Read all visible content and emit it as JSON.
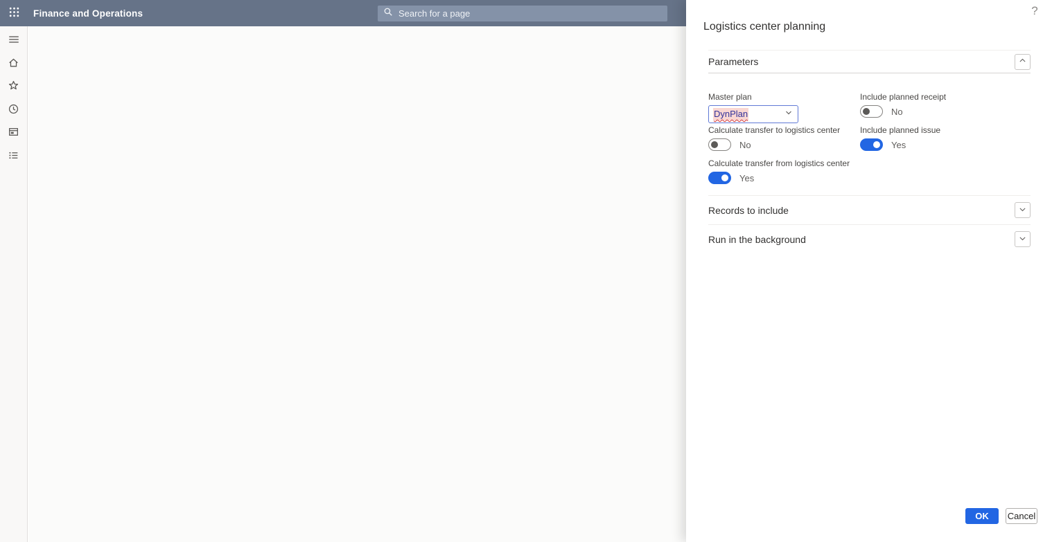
{
  "topbar": {
    "app_title": "Finance and Operations",
    "search_placeholder": "Search for a page"
  },
  "sidebar": {
    "icons": [
      {
        "name": "menu-icon"
      },
      {
        "name": "home-icon"
      },
      {
        "name": "favorites-star-icon"
      },
      {
        "name": "recent-clock-icon"
      },
      {
        "name": "workspace-icon"
      },
      {
        "name": "modules-list-icon"
      }
    ]
  },
  "help": {
    "label": "?"
  },
  "panel": {
    "title": "Logistics center planning",
    "sections": [
      {
        "label": "Parameters",
        "expanded": true
      },
      {
        "label": "Records to include",
        "expanded": false
      },
      {
        "label": "Run in the background",
        "expanded": false
      }
    ],
    "fields": {
      "master_plan": {
        "label": "Master plan",
        "value": "DynPlan"
      },
      "include_planned_receipt": {
        "label": "Include planned receipt",
        "value": "No",
        "on": false
      },
      "calculate_transfer_to": {
        "label": "Calculate transfer to logistics center",
        "value": "No",
        "on": false
      },
      "include_planned_issue": {
        "label": "Include planned issue",
        "value": "Yes",
        "on": true
      },
      "calculate_transfer_from": {
        "label": "Calculate transfer from logistics center",
        "value": "Yes",
        "on": true
      }
    },
    "footer": {
      "ok_label": "OK",
      "cancel_label": "Cancel"
    }
  },
  "colors": {
    "accent": "#2266e3",
    "topbar_bg": "#667388",
    "search_bg": "#8492a8",
    "toggle_on": "#2266e3",
    "dropdown_border_focus": "#6079d6",
    "selection_highlight": "#f9d7d3",
    "spellcheck_red": "#d13438"
  }
}
